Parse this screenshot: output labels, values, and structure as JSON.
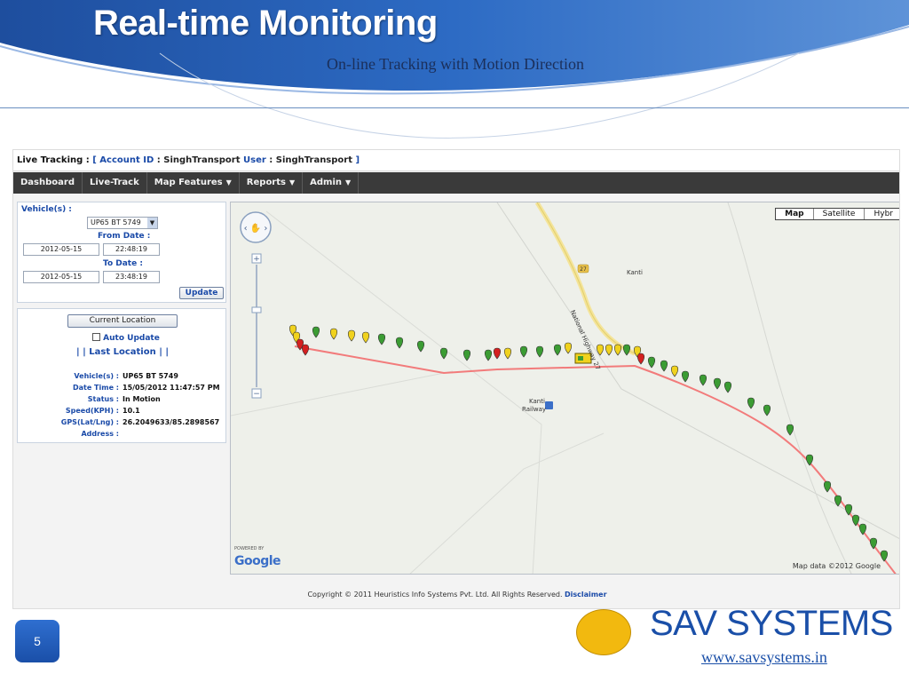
{
  "slide": {
    "title": "Real-time Monitoring",
    "subtitle": "On-line Tracking with Motion Direction",
    "page_number": "5",
    "brand": "SAV SYSTEMS",
    "url": "www.savsystems.in"
  },
  "app": {
    "live_bar": {
      "prefix": "Live Tracking :",
      "bracket_open": "[",
      "account_label": "Account ID",
      "account_value": ": SinghTransport",
      "user_label": "User",
      "user_value": ": SinghTransport",
      "bracket_close": "]"
    },
    "nav": {
      "dashboard": "Dashboard",
      "live_track": "Live-Track",
      "map_features": "Map Features",
      "reports": "Reports",
      "admin": "Admin"
    },
    "vehicle_panel": {
      "vehicles_label": "Vehicle(s) :",
      "vehicle_selected": "UP65 BT 5749",
      "from_date_label": "From Date :",
      "from_date": "2012-05-15",
      "from_time": "22:48:19",
      "to_date_label": "To Date :",
      "to_date": "2012-05-15",
      "to_time": "23:48:19",
      "update_button": "Update"
    },
    "location_panel": {
      "current_location_button": "Current Location",
      "auto_update_label": "Auto Update",
      "last_location_link": "| | Last Location | |",
      "rows": [
        {
          "key": "Vehicle(s) :",
          "value": "UP65 BT 5749"
        },
        {
          "key": "Date Time :",
          "value": "15/05/2012 11:47:57 PM"
        },
        {
          "key": "Status :",
          "value": "In Motion"
        },
        {
          "key": "Speed(KPH) :",
          "value": "10.1"
        },
        {
          "key": "GPS(Lat/Lng) :",
          "value": "26.2049633/85.2898567"
        },
        {
          "key": "Address :",
          "value": ""
        }
      ]
    },
    "map": {
      "type_buttons": [
        "Map",
        "Satellite",
        "Hybr"
      ],
      "active_type": "Map",
      "labels": {
        "kanti": "Kanti",
        "kanti_railway_1": "Kanti",
        "kanti_railway_2": "Railway",
        "highway": "National Highway 27",
        "shield": "27"
      },
      "powered_by": "POWERED BY",
      "google": "Google",
      "credit": "Map data ©2012 Google"
    },
    "copyright": "Copyright © 2011 Heuristics Info Systems Pvt. Ltd. All Rights Reserved.",
    "disclaimer": "Disclaimer"
  },
  "colors": {
    "brand_blue": "#1a4fa8",
    "nav_bg": "#3a3a3a",
    "route": "#f27b7b",
    "marker_green": "#3b9c33",
    "marker_yellow": "#f0d21e",
    "marker_red": "#d42020",
    "logo_yellow": "#f2b90f"
  }
}
